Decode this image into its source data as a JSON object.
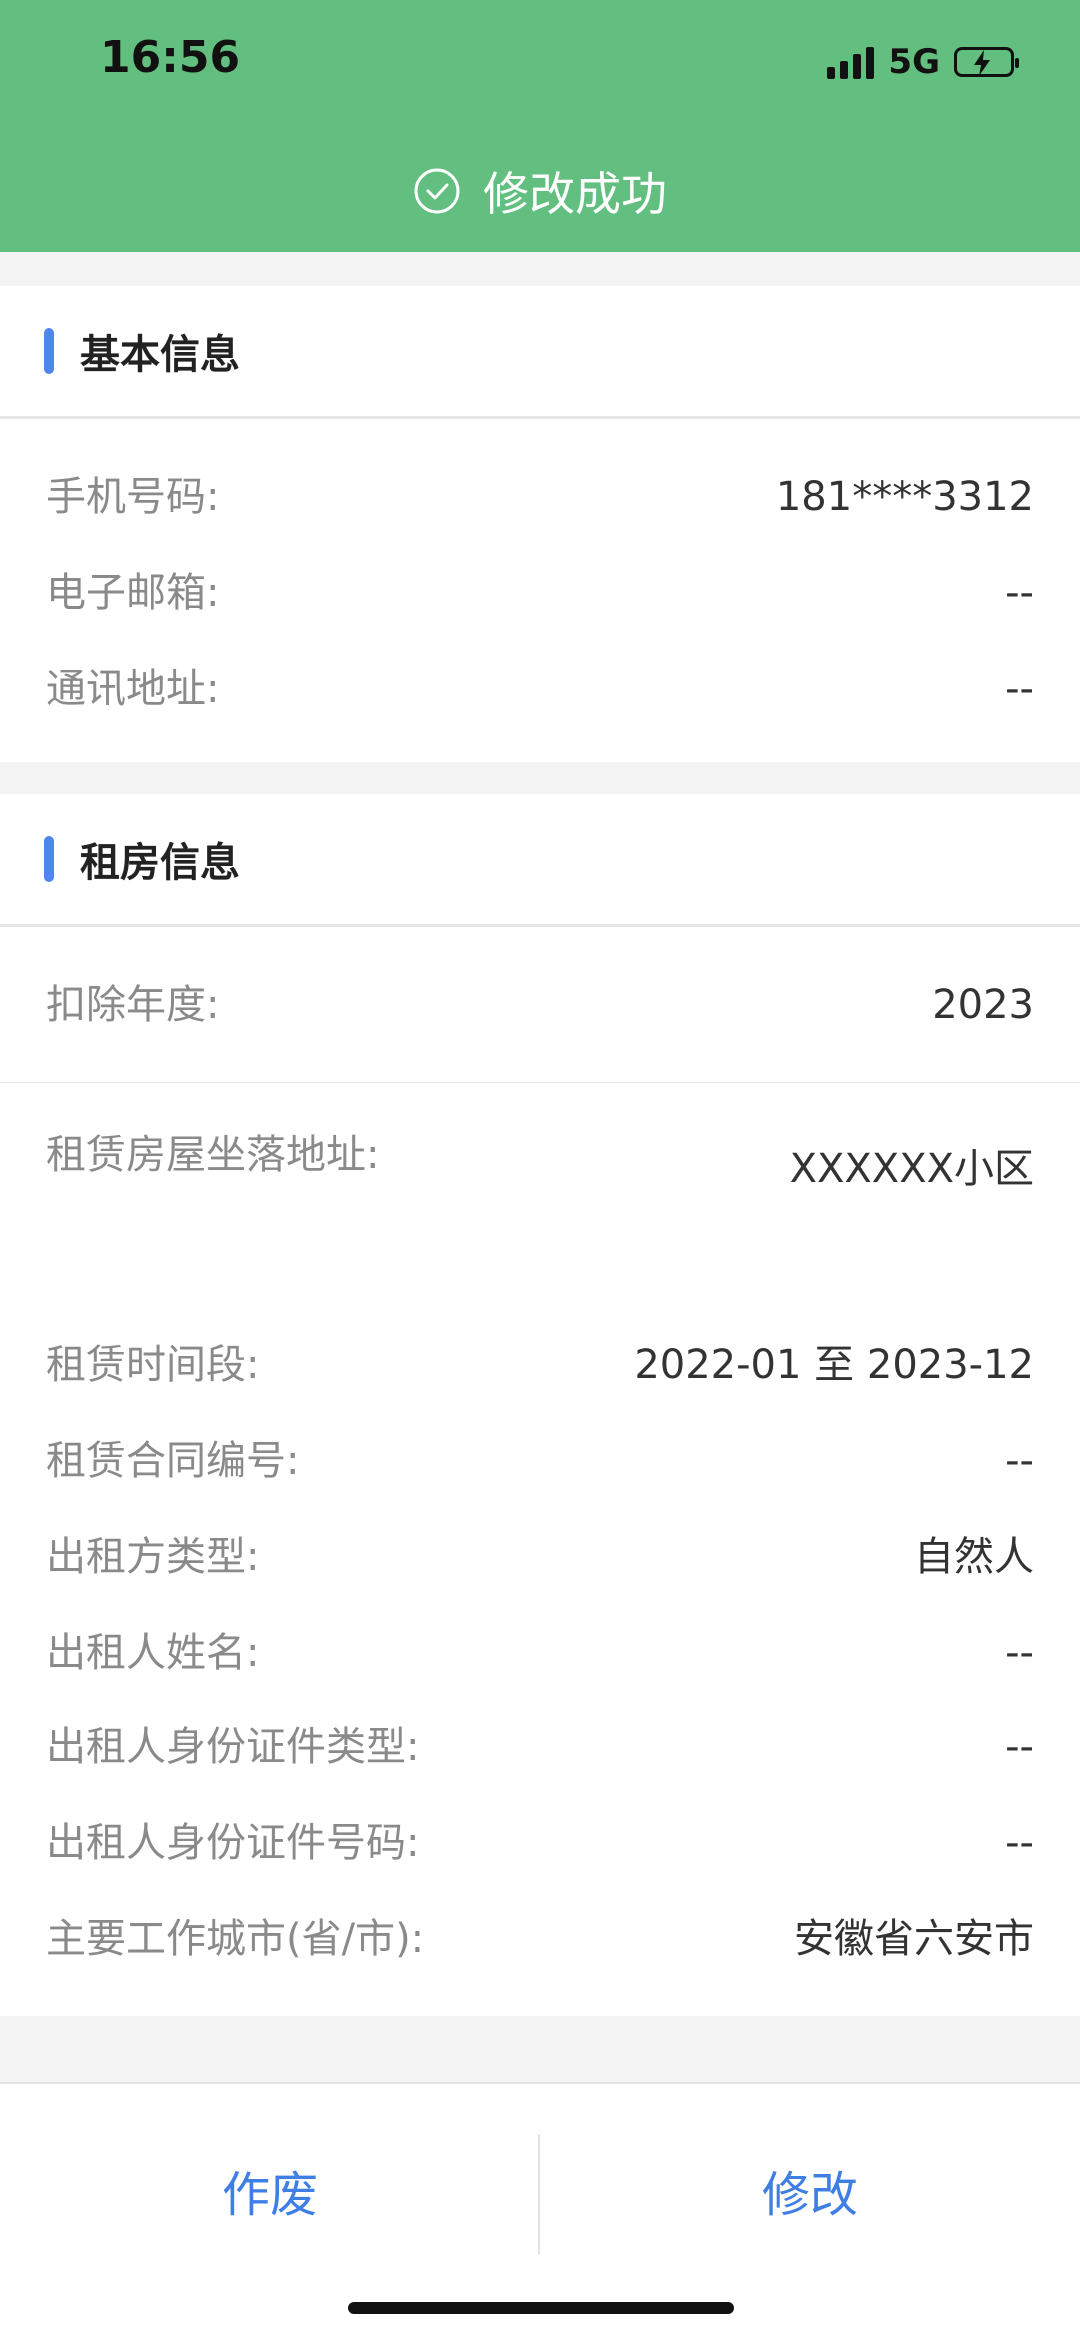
{
  "status_bar": {
    "time": "16:56",
    "network": "5G"
  },
  "toast": {
    "message": "修改成功"
  },
  "basic_info": {
    "title": "基本信息",
    "rows": [
      {
        "label": "手机号码:",
        "value": "181****3312"
      },
      {
        "label": "电子邮箱:",
        "value": "--"
      },
      {
        "label": "通讯地址:",
        "value": "--"
      }
    ]
  },
  "rental_info": {
    "title": "租房信息",
    "year_row": {
      "label": "扣除年度:",
      "value": "2023"
    },
    "address_row": {
      "label": "租赁房屋坐落地址:",
      "value": "XXXXXX小区"
    },
    "rows": [
      {
        "label": "租赁时间段:",
        "value": "2022-01 至 2023-12"
      },
      {
        "label": "租赁合同编号:",
        "value": "--"
      },
      {
        "label": "出租方类型:",
        "value": "自然人"
      },
      {
        "label": "出租人姓名:",
        "value": "--"
      },
      {
        "label": "出租人身份证件类型:",
        "value": "--"
      },
      {
        "label": "出租人身份证件号码:",
        "value": "--"
      },
      {
        "label": "主要工作城市(省/市):",
        "value": "安徽省六安市"
      }
    ]
  },
  "actions": {
    "void_label": "作废",
    "edit_label": "修改"
  },
  "colors": {
    "header_green": "#62bf7f",
    "accent_blue": "#4f86ee",
    "button_blue": "#3f7fe4"
  }
}
